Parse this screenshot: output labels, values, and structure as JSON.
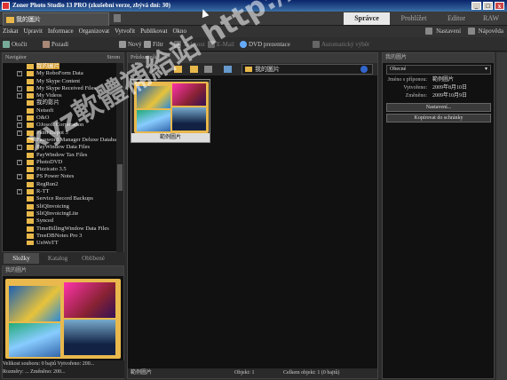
{
  "window": {
    "title": "Zoner Photo Studio 13 PRO (zkušební verze, zbývá dní: 30)",
    "minimize": "_",
    "maximize": "□",
    "close": "x"
  },
  "doc_tab": "我的圖片",
  "modes": [
    "Správce",
    "Prohlížet",
    "Editor",
    "RAW"
  ],
  "menu": [
    "Získat",
    "Upravit",
    "Informace",
    "Organizovat",
    "Vytvořit",
    "Publikovat",
    "Okno"
  ],
  "menu_right": [
    "Nastavení",
    "Nápověda"
  ],
  "toolbar": [
    "Otočit",
    "Pozadí",
    "Nový",
    "Filtr",
    "Tisknout",
    "E-Mail",
    "DVD prezentace",
    "Automatický výběr"
  ],
  "left_header": "Navigátor",
  "left_header_right": "Strom",
  "tree": [
    {
      "label": "我的圖片",
      "expander": "",
      "selected": true
    },
    {
      "label": "My RoboForm Data",
      "expander": "+",
      "selected": false
    },
    {
      "label": "My Skype Content",
      "expander": "",
      "selected": false
    },
    {
      "label": "My Skype Received Files",
      "expander": "+",
      "selected": false
    },
    {
      "label": "My Videos",
      "expander": "+",
      "selected": false
    },
    {
      "label": "我的影片",
      "expander": "",
      "selected": false
    },
    {
      "label": "Netsoft",
      "expander": "",
      "selected": false
    },
    {
      "label": "O&O",
      "expander": "+",
      "selected": false
    },
    {
      "label": "OJosoft Corporation",
      "expander": "+",
      "selected": false
    },
    {
      "label": "Paint Depot 5",
      "expander": "+",
      "selected": false
    },
    {
      "label": "Password Manager Deluxe Database",
      "expander": "",
      "selected": false
    },
    {
      "label": "PayWindow Data Files",
      "expander": "+",
      "selected": false
    },
    {
      "label": "PayWindow Tax Files",
      "expander": "",
      "selected": false
    },
    {
      "label": "PhotoDVD",
      "expander": "+",
      "selected": false
    },
    {
      "label": "Pizzicato 3.5",
      "expander": "",
      "selected": false
    },
    {
      "label": "PS Power Notes",
      "expander": "+",
      "selected": false
    },
    {
      "label": "RegRun2",
      "expander": "",
      "selected": false
    },
    {
      "label": "R-TT",
      "expander": "+",
      "selected": false
    },
    {
      "label": "Service Record Backups",
      "expander": "",
      "selected": false
    },
    {
      "label": "SliQInvoicing",
      "expander": "",
      "selected": false
    },
    {
      "label": "SliQInvoicingLite",
      "expander": "",
      "selected": false
    },
    {
      "label": "Synced",
      "expander": "",
      "selected": false
    },
    {
      "label": "TimeBillingWindow Data Files",
      "expander": "",
      "selected": false
    },
    {
      "label": "TreeDBNotes Pro 3",
      "expander": "",
      "selected": false
    },
    {
      "label": "UnWoTT",
      "expander": "",
      "selected": false
    }
  ],
  "bottom_tabs": [
    "Složky",
    "Katalog",
    "Oblíbené"
  ],
  "preview_header": "我的圖片",
  "info_lines": [
    "Velikost souboru: 0 bajtů  Vytvořeno: 200...",
    "Rozměry: ...  Změněno: 200..."
  ],
  "mid_header": "Průzkumník",
  "address": "我的圖片",
  "thumb_caption": "範例圖片",
  "status": {
    "left": "範例圖片",
    "objects": "Objekt: 1",
    "total": "Celkem objekt: 1 (0 bajtů)"
  },
  "right_header": "我的圖片",
  "dropdown": "Obecné",
  "info_rows": [
    {
      "k": "Jméno s příponou:",
      "v": "範例圖片"
    },
    {
      "k": "Vytvořeno:",
      "v": "2009年8月10日"
    },
    {
      "k": "Změněno:",
      "v": "2009年10月9日"
    }
  ],
  "btn_nastaveni": "Nastavení...",
  "btn_kopirovat": "Kopírovat do schránky",
  "watermark": "xyz軟體補給站 http://31.to",
  "colors": {
    "selection": "#d49a2a",
    "folder": "#e9b94d",
    "accent": "#3a6ea5"
  }
}
